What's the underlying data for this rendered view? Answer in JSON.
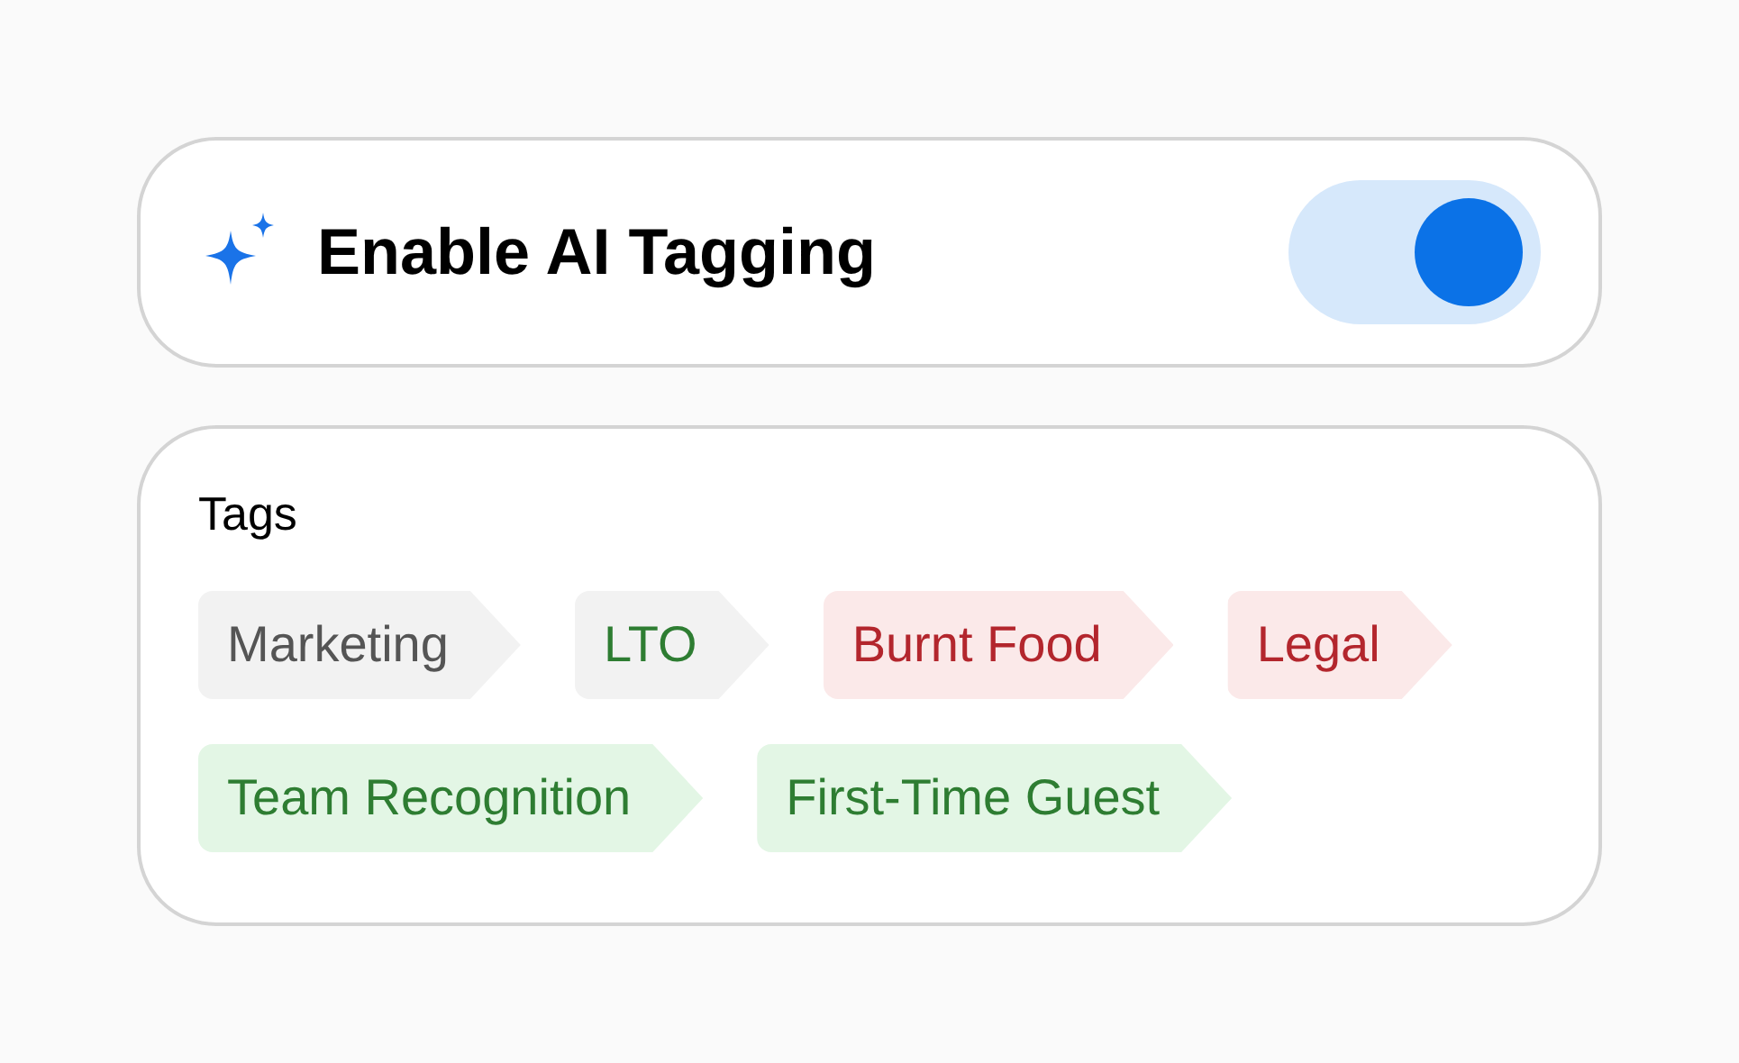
{
  "setting": {
    "label": "Enable AI Tagging",
    "on": true
  },
  "tags_panel": {
    "title": "Tags",
    "tags": [
      {
        "label": "Marketing",
        "color": "#555555",
        "kind": "neutral"
      },
      {
        "label": "LTO",
        "color": "#2e7d32",
        "kind": "neutral"
      },
      {
        "label": "Burnt Food",
        "color": "#b3262d",
        "kind": "negative"
      },
      {
        "label": "Legal",
        "color": "#b3262d",
        "kind": "negative"
      },
      {
        "label": "Team Recognition",
        "color": "#2e7d32",
        "kind": "positive"
      },
      {
        "label": "First-Time Guest",
        "color": "#2e7d32",
        "kind": "positive"
      }
    ]
  }
}
